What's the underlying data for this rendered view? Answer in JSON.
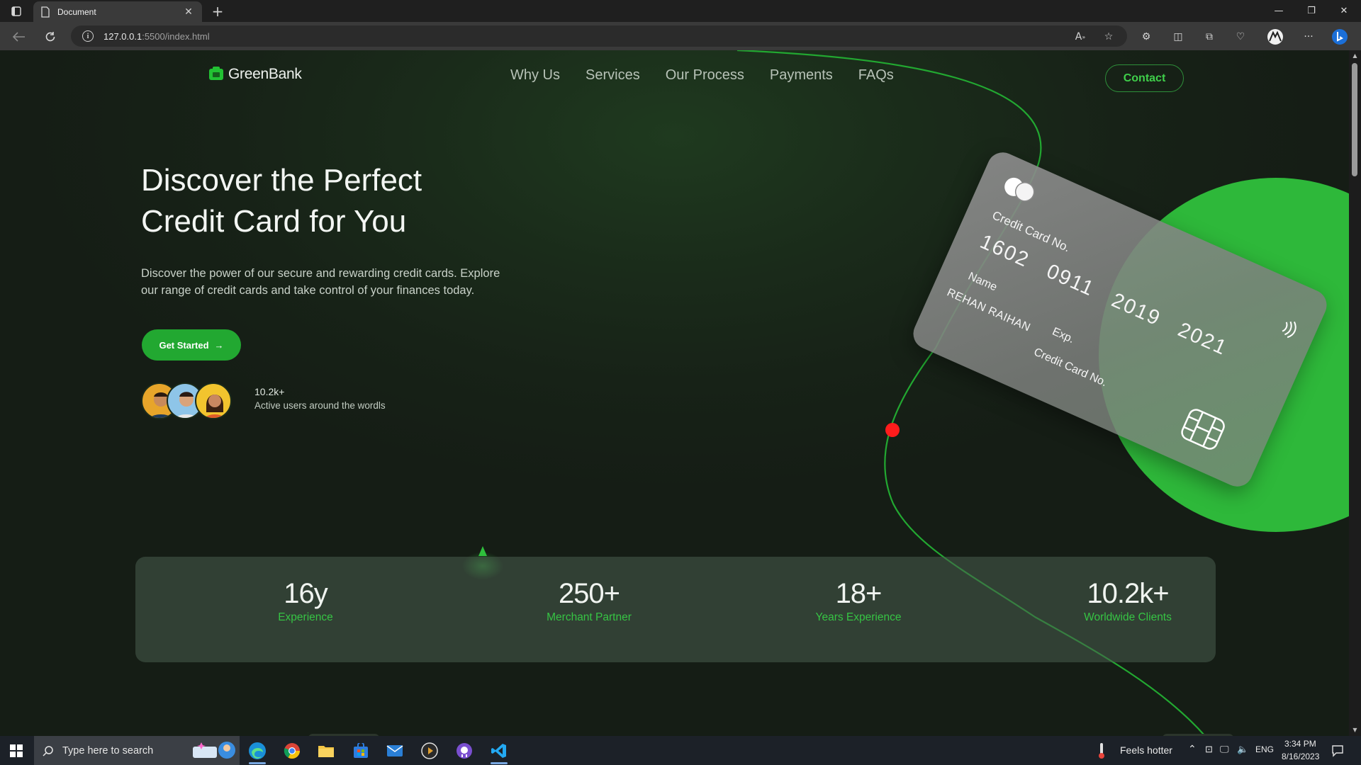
{
  "browser": {
    "tab_title": "Document",
    "url_host": "127.0.0.1",
    "url_rest": ":5500/index.html",
    "new_tab": "+",
    "close_tab": "✕"
  },
  "site": {
    "brand": "GreenBank",
    "nav": [
      "Why Us",
      "Services",
      "Our Process",
      "Payments",
      "FAQs"
    ],
    "contact_label": "Contact",
    "hero_title_line1": "Discover the Perfect",
    "hero_title_line2": "Credit Card for You",
    "hero_desc": "Discover the power of our secure and rewarding credit cards. Explore our range of credit cards and take control of your finances today.",
    "cta_label": "Get Started",
    "cta_arrow": "→",
    "users_count": "10.2k+",
    "users_label": "Active users around the wordls",
    "accent_color": "#22a831"
  },
  "card": {
    "label_top": "Credit Card No.",
    "number": "1602 0911 2019 2021",
    "name_label": "Name",
    "name_value": "REHAN RAIHAN",
    "exp_label": "Exp.",
    "label_bottom": "Credit Card No."
  },
  "stats": [
    {
      "value": "16y",
      "label": "Experience"
    },
    {
      "value": "250+",
      "label": "Merchant Partner"
    },
    {
      "value": "18+",
      "label": "Years Experience"
    },
    {
      "value": "10.2k+",
      "label": "Worldwide Clients"
    }
  ],
  "taskbar": {
    "search_placeholder": "Type here to search",
    "weather": "Feels hotter",
    "lang": "ENG",
    "time": "3:34 PM",
    "date": "8/16/2023"
  }
}
